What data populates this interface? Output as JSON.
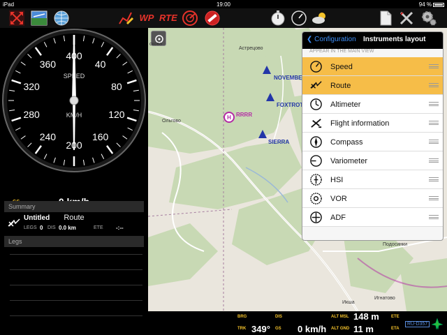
{
  "status_bar": {
    "device": "iPad",
    "time": "19:00",
    "battery": "94 %"
  },
  "toolbar": {
    "icons": [
      "fullscreen-icon",
      "layers-icon",
      "globe-icon",
      "route-edit-icon",
      "wp-icon",
      "rte-icon",
      "radar-icon",
      "no-entry-icon",
      "stopwatch-icon",
      "gauge-icon",
      "weather-icon",
      "document-icon",
      "tools-icon",
      "settings-icon"
    ],
    "wp_label": "WP",
    "rte_label": "RTE"
  },
  "speed_gauge": {
    "title": "SPEED",
    "unit": "KM/H",
    "ticks": [
      "40",
      "80",
      "120",
      "160",
      "200",
      "240",
      "280",
      "320",
      "360",
      "400"
    ],
    "value": 0
  },
  "speed_readout": {
    "label": "GS",
    "value": "0 km/h"
  },
  "route_title": "Route",
  "summary": {
    "header": "Summary",
    "route_name": "Untitled",
    "legs_label": "LEGS",
    "legs_value": "0",
    "dis_label": "DIS",
    "dis_value": "0.0 km",
    "ete_label": "ETE",
    "ete_value": "-:--"
  },
  "legs": {
    "header": "Legs"
  },
  "map": {
    "places": [
      "Астрецово",
      "Ольгово",
      "Подосинки",
      "Игнатово",
      "Икша",
      "сково"
    ],
    "waypoints": [
      "NOVEMBER",
      "FOXTROT",
      "SIERRA"
    ],
    "heliport": "RRRR",
    "colors": {
      "forest": "#c8d9b4",
      "open": "#eae6dd",
      "road": "#ffffff",
      "waypoint": "#2336a8",
      "heliport": "#b42aa5"
    }
  },
  "bottom_bar": {
    "brg_label": "BRG",
    "trk_label": "TRK",
    "trk_value": "349°",
    "dis_label": "DIS",
    "gs_label": "GS",
    "gs_value": "0 km/h",
    "alt_msl_label": "ALT MSL",
    "alt_msl_value": "148 m",
    "alt_gnd_label": "ALT GND",
    "alt_gnd_value": "11 m",
    "ete_label": "ETE",
    "eta_label": "ETA",
    "airspace_label": "RU-D357"
  },
  "config_panel": {
    "back_label": "Configuration",
    "title": "Instruments layout",
    "subheader": "APPEAR IN THE MAIN VIEW",
    "items": [
      {
        "label": "Speed",
        "icon": "speed-icon",
        "selected": true
      },
      {
        "label": "Route",
        "icon": "route-icon",
        "selected": true
      },
      {
        "label": "Altimeter",
        "icon": "altimeter-icon",
        "selected": false
      },
      {
        "label": "Flight information",
        "icon": "flight-info-icon",
        "selected": false
      },
      {
        "label": "Compass",
        "icon": "compass-icon",
        "selected": false
      },
      {
        "label": "Variometer",
        "icon": "variometer-icon",
        "selected": false
      },
      {
        "label": "HSI",
        "icon": "hsi-icon",
        "selected": false
      },
      {
        "label": "VOR",
        "icon": "vor-icon",
        "selected": false
      },
      {
        "label": "ADF",
        "icon": "adf-icon",
        "selected": false
      }
    ]
  },
  "colors": {
    "accent": "#f4c22a",
    "selected_row": "#f6bd48",
    "link": "#3e8ef7"
  }
}
